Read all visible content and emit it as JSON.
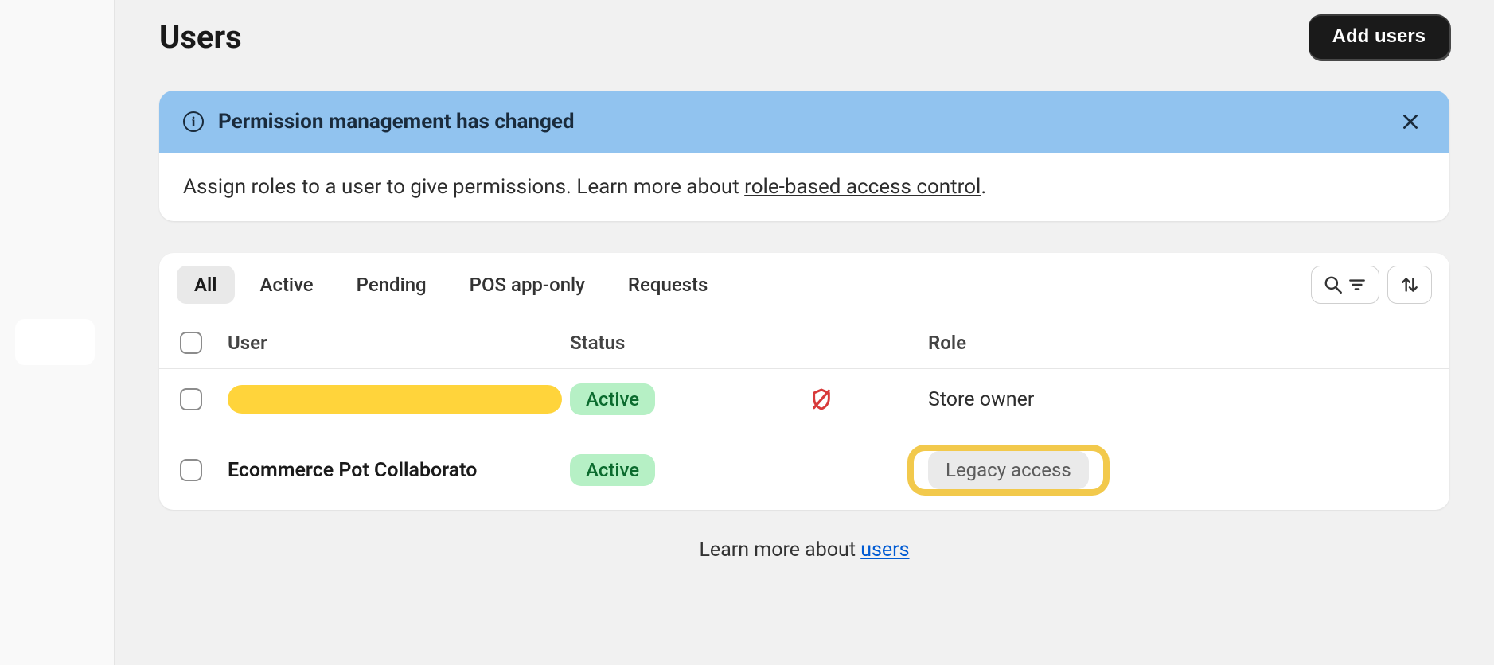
{
  "page": {
    "title": "Users",
    "add_button": "Add users"
  },
  "banner": {
    "title": "Permission management has changed",
    "body_prefix": "Assign roles to a user to give permissions. Learn more about ",
    "body_link": "role-based access control",
    "body_suffix": "."
  },
  "tabs": {
    "items": [
      "All",
      "Active",
      "Pending",
      "POS app-only",
      "Requests"
    ],
    "selected_index": 0
  },
  "columns": {
    "user": "User",
    "status": "Status",
    "role": "Role"
  },
  "rows": [
    {
      "user": "",
      "redacted": true,
      "status": "Active",
      "has_shield_icon": true,
      "role_text": "Store owner",
      "role_is_pill": false,
      "highlighted": false
    },
    {
      "user": "Ecommerce Pot Collaborato",
      "redacted": false,
      "status": "Active",
      "has_shield_icon": false,
      "role_text": "Legacy access",
      "role_is_pill": true,
      "highlighted": true
    }
  ],
  "footer": {
    "prefix": "Learn more about ",
    "link": "users"
  }
}
